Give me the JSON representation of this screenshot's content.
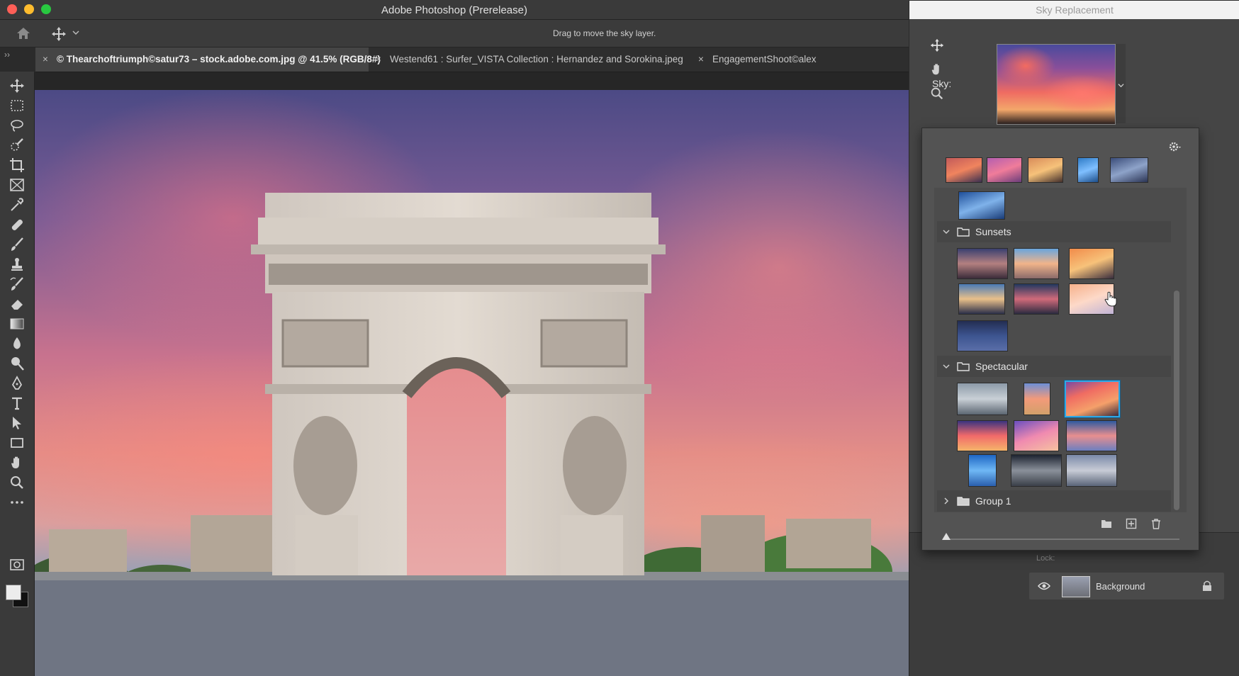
{
  "app": {
    "title": "Adobe Photoshop (Prerelease)"
  },
  "options_bar": {
    "hint": "Drag to move the sky layer."
  },
  "tabs": [
    {
      "label": "© Thearchoftriumph©satur73 – stock.adobe.com.jpg @ 41.5% (RGB/8#)",
      "active": true
    },
    {
      "label": "Westend61 : Surfer_VISTA Collection : Hernandez and Sorokina.jpeg",
      "active": false
    },
    {
      "label": "EngagementShoot©alex",
      "active": false
    }
  ],
  "tools": [
    "move-icon",
    "marquee-icon",
    "lasso-icon",
    "quick-select-icon",
    "crop-icon",
    "frame-icon",
    "eyedropper-icon",
    "healing-icon",
    "brush-icon",
    "stamp-icon",
    "history-brush-icon",
    "eraser-icon",
    "gradient-icon",
    "blur-icon",
    "dodge-icon",
    "pen-icon",
    "type-icon",
    "path-select-icon",
    "rectangle-icon",
    "hand-icon",
    "zoom-icon",
    "more-icon"
  ],
  "dialog": {
    "title": "Sky Replacement",
    "sky_label": "Sky:",
    "tools": [
      "move-icon",
      "hand-icon",
      "zoom-icon"
    ]
  },
  "sky_picker": {
    "groups": [
      {
        "name": "Sunsets",
        "expanded": true
      },
      {
        "name": "Spectacular",
        "expanded": true
      },
      {
        "name": "Group 1",
        "expanded": false
      }
    ]
  },
  "layers": {
    "lock_label": "Lock:",
    "background_layer": "Background"
  },
  "colors": {
    "accent": "#2fa8e6",
    "foreground_swatch": "#ececec",
    "background_swatch": "#111111"
  }
}
